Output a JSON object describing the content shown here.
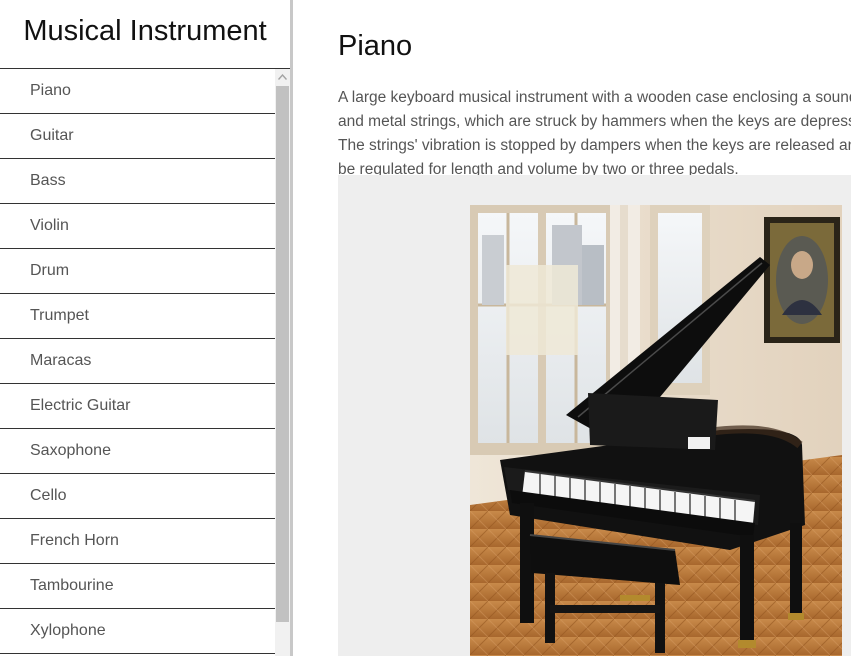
{
  "sidebar": {
    "title": "Musical Instrument",
    "items": [
      {
        "label": "Piano"
      },
      {
        "label": "Guitar"
      },
      {
        "label": "Bass"
      },
      {
        "label": "Violin"
      },
      {
        "label": "Drum"
      },
      {
        "label": "Trumpet"
      },
      {
        "label": "Maracas"
      },
      {
        "label": "Electric Guitar"
      },
      {
        "label": "Saxophone"
      },
      {
        "label": "Cello"
      },
      {
        "label": "French Horn"
      },
      {
        "label": "Tambourine"
      },
      {
        "label": "Xylophone"
      }
    ]
  },
  "main": {
    "title": "Piano",
    "description": "A large keyboard musical instrument with a wooden case enclosing a soundboard and metal strings, which are struck by hammers when the keys are depressed. The strings' vibration is stopped by dampers when the keys are released and can be regulated for length and volume by two or three pedals.",
    "image": {
      "subject": "grand-piano-photo",
      "panel_color": "#eeeeee"
    }
  },
  "colors": {
    "divider": "#c8c8c8",
    "item_border": "#333333",
    "item_text": "#555555",
    "title_text": "#111111",
    "scrollbar_track": "#f1f1f1",
    "scrollbar_thumb": "#c1c1c1"
  },
  "icons": {
    "scroll_up": "chevron-up-icon"
  }
}
